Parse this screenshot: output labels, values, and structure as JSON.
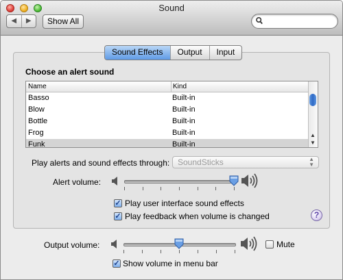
{
  "window": {
    "title": "Sound"
  },
  "toolbar": {
    "back_glyph": "◀",
    "forward_glyph": "▶",
    "show_all_label": "Show All",
    "search_value": ""
  },
  "tabs": [
    {
      "label": "Sound Effects",
      "active": true
    },
    {
      "label": "Output",
      "active": false
    },
    {
      "label": "Input",
      "active": false
    }
  ],
  "alert_section": {
    "heading": "Choose an alert sound",
    "columns": [
      "Name",
      "Kind"
    ],
    "rows": [
      {
        "name": "Basso",
        "kind": "Built-in"
      },
      {
        "name": "Blow",
        "kind": "Built-in"
      },
      {
        "name": "Bottle",
        "kind": "Built-in"
      },
      {
        "name": "Frog",
        "kind": "Built-in"
      },
      {
        "name": "Funk",
        "kind": "Built-in"
      }
    ],
    "selected_row": "Funk"
  },
  "play_through": {
    "label": "Play alerts and sound effects through:",
    "value": "SoundSticks",
    "enabled": false
  },
  "alert_volume": {
    "label": "Alert volume:",
    "level": 1.0
  },
  "checkboxes": {
    "ui_effects": {
      "label": "Play user interface sound effects",
      "checked": true
    },
    "feedback": {
      "label": "Play feedback when volume is changed",
      "checked": true
    },
    "show_volume": {
      "label": "Show volume in menu bar",
      "checked": true
    },
    "mute": {
      "label": "Mute",
      "checked": false
    }
  },
  "output_volume": {
    "label": "Output volume:",
    "level": 0.5
  },
  "help": {
    "glyph": "?"
  },
  "icons": {
    "search": "magnifier-icon",
    "speaker_quiet": "speaker-low-icon",
    "speaker_loud": "speaker-high-icon"
  }
}
